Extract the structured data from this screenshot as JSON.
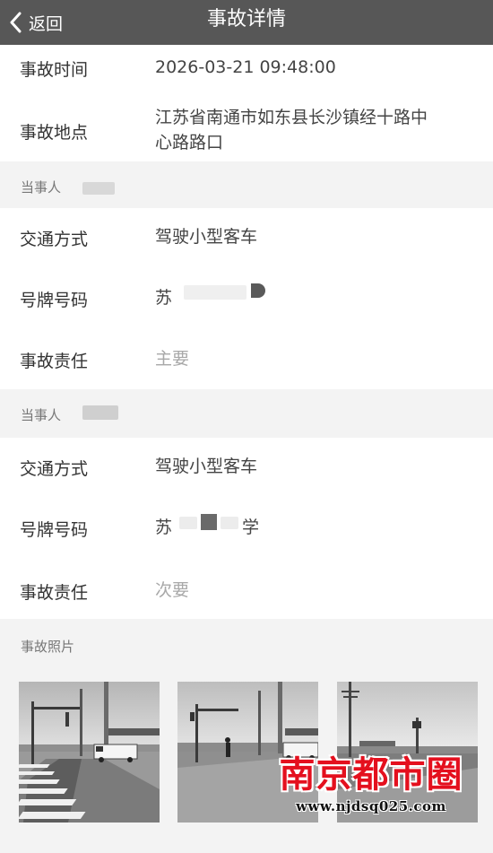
{
  "navbar": {
    "back_label": "返回",
    "title": "事故详情"
  },
  "accident": {
    "time_label": "事故时间",
    "time_value": "2026-03-21 09:48:00",
    "location_label": "事故地点",
    "location_line1": "江苏省南通市如东县长沙镇经十路中",
    "location_line2": "心路路口"
  },
  "parties": [
    {
      "header": "当事人",
      "mode_label": "交通方式",
      "mode_value": "驾驶小型客车",
      "plate_label": "号牌号码",
      "plate_prefix": "苏",
      "plate_suffix": "",
      "liability_label": "事故责任",
      "liability_value": "主要"
    },
    {
      "header": "当事人",
      "mode_label": "交通方式",
      "mode_value": "驾驶小型客车",
      "plate_label": "号牌号码",
      "plate_prefix": "苏",
      "plate_suffix": "学",
      "liability_label": "事故责任",
      "liability_value": "次要"
    }
  ],
  "photos": {
    "header": "事故照片",
    "count": 3
  },
  "watermark": {
    "text": "南京都市圈",
    "url": "www.njdsq025.com",
    "color": "#e4101e"
  },
  "colors": {
    "navbar": "#575757",
    "section_bg": "#f3f3f3",
    "muted_text": "#a8a8a8"
  },
  "icons": [
    "chevron-left-icon"
  ]
}
